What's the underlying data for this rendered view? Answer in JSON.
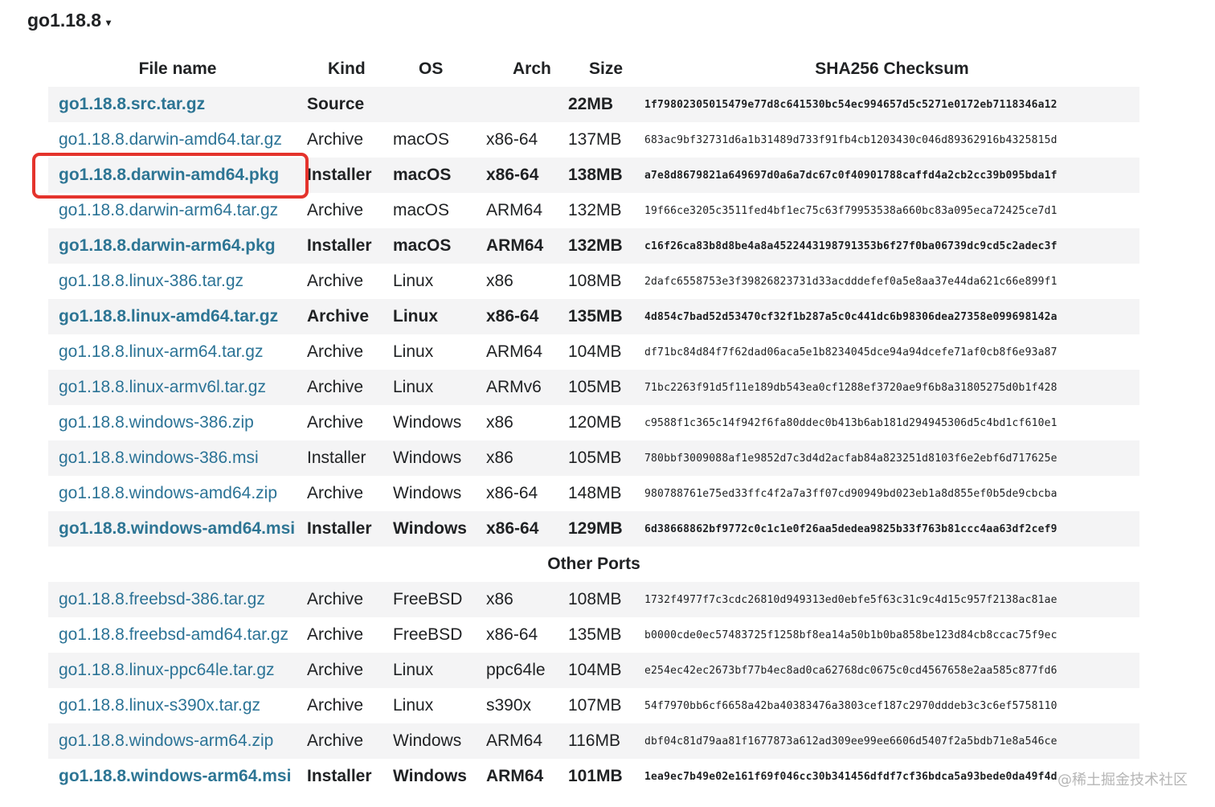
{
  "header": {
    "version": "go1.18.8",
    "caret": "▾"
  },
  "table": {
    "headers": {
      "file_name": "File name",
      "kind": "Kind",
      "os": "OS",
      "arch": "Arch",
      "size": "Size",
      "checksum": "SHA256 Checksum"
    },
    "rows": [
      {
        "name": "go1.18.8.src.tar.gz",
        "kind": "Source",
        "os": "",
        "arch": "",
        "size": "22MB",
        "sum": "1f79802305015479e77d8c641530bc54ec994657d5c5271e0172eb7118346a12",
        "featured": true,
        "shaded": true
      },
      {
        "name": "go1.18.8.darwin-amd64.tar.gz",
        "kind": "Archive",
        "os": "macOS",
        "arch": "x86-64",
        "size": "137MB",
        "sum": "683ac9bf32731d6a1b31489d733f91fb4cb1203430c046d89362916b4325815d",
        "featured": false,
        "shaded": false
      },
      {
        "name": "go1.18.8.darwin-amd64.pkg",
        "kind": "Installer",
        "os": "macOS",
        "arch": "x86-64",
        "size": "138MB",
        "sum": "a7e8d8679821a649697d0a6a7dc67c0f40901788caffd4a2cb2cc39b095bda1f",
        "featured": true,
        "shaded": true
      },
      {
        "name": "go1.18.8.darwin-arm64.tar.gz",
        "kind": "Archive",
        "os": "macOS",
        "arch": "ARM64",
        "size": "132MB",
        "sum": "19f66ce3205c3511fed4bf1ec75c63f79953538a660bc83a095eca72425ce7d1",
        "featured": false,
        "shaded": false
      },
      {
        "name": "go1.18.8.darwin-arm64.pkg",
        "kind": "Installer",
        "os": "macOS",
        "arch": "ARM64",
        "size": "132MB",
        "sum": "c16f26ca83b8d8be4a8a4522443198791353b6f27f0ba06739dc9cd5c2adec3f",
        "featured": true,
        "shaded": true
      },
      {
        "name": "go1.18.8.linux-386.tar.gz",
        "kind": "Archive",
        "os": "Linux",
        "arch": "x86",
        "size": "108MB",
        "sum": "2dafc6558753e3f39826823731d33acdddefef0a5e8aa37e44da621c66e899f1",
        "featured": false,
        "shaded": false
      },
      {
        "name": "go1.18.8.linux-amd64.tar.gz",
        "kind": "Archive",
        "os": "Linux",
        "arch": "x86-64",
        "size": "135MB",
        "sum": "4d854c7bad52d53470cf32f1b287a5c0c441dc6b98306dea27358e099698142a",
        "featured": true,
        "shaded": true
      },
      {
        "name": "go1.18.8.linux-arm64.tar.gz",
        "kind": "Archive",
        "os": "Linux",
        "arch": "ARM64",
        "size": "104MB",
        "sum": "df71bc84d84f7f62dad06aca5e1b8234045dce94a94dcefe71af0cb8f6e93a87",
        "featured": false,
        "shaded": false
      },
      {
        "name": "go1.18.8.linux-armv6l.tar.gz",
        "kind": "Archive",
        "os": "Linux",
        "arch": "ARMv6",
        "size": "105MB",
        "sum": "71bc2263f91d5f11e189db543ea0cf1288ef3720ae9f6b8a31805275d0b1f428",
        "featured": false,
        "shaded": true
      },
      {
        "name": "go1.18.8.windows-386.zip",
        "kind": "Archive",
        "os": "Windows",
        "arch": "x86",
        "size": "120MB",
        "sum": "c9588f1c365c14f942f6fa80ddec0b413b6ab181d294945306d5c4bd1cf610e1",
        "featured": false,
        "shaded": false
      },
      {
        "name": "go1.18.8.windows-386.msi",
        "kind": "Installer",
        "os": "Windows",
        "arch": "x86",
        "size": "105MB",
        "sum": "780bbf3009088af1e9852d7c3d4d2acfab84a823251d8103f6e2ebf6d717625e",
        "featured": false,
        "shaded": true
      },
      {
        "name": "go1.18.8.windows-amd64.zip",
        "kind": "Archive",
        "os": "Windows",
        "arch": "x86-64",
        "size": "148MB",
        "sum": "980788761e75ed33ffc4f2a7a3ff07cd90949bd023eb1a8d855ef0b5de9cbcba",
        "featured": false,
        "shaded": false
      },
      {
        "name": "go1.18.8.windows-amd64.msi",
        "kind": "Installer",
        "os": "Windows",
        "arch": "x86-64",
        "size": "129MB",
        "sum": "6d38668862bf9772c0c1c1e0f26aa5dedea9825b33f763b81ccc4aa63df2cef9",
        "featured": true,
        "shaded": true
      }
    ],
    "section_label": "Other Ports",
    "other_rows": [
      {
        "name": "go1.18.8.freebsd-386.tar.gz",
        "kind": "Archive",
        "os": "FreeBSD",
        "arch": "x86",
        "size": "108MB",
        "sum": "1732f4977f7c3cdc26810d949313ed0ebfe5f63c31c9c4d15c957f2138ac81ae",
        "featured": false,
        "shaded": true
      },
      {
        "name": "go1.18.8.freebsd-amd64.tar.gz",
        "kind": "Archive",
        "os": "FreeBSD",
        "arch": "x86-64",
        "size": "135MB",
        "sum": "b0000cde0ec57483725f1258bf8ea14a50b1b0ba858be123d84cb8ccac75f9ec",
        "featured": false,
        "shaded": false
      },
      {
        "name": "go1.18.8.linux-ppc64le.tar.gz",
        "kind": "Archive",
        "os": "Linux",
        "arch": "ppc64le",
        "size": "104MB",
        "sum": "e254ec42ec2673bf77b4ec8ad0ca62768dc0675c0cd4567658e2aa585c877fd6",
        "featured": false,
        "shaded": true
      },
      {
        "name": "go1.18.8.linux-s390x.tar.gz",
        "kind": "Archive",
        "os": "Linux",
        "arch": "s390x",
        "size": "107MB",
        "sum": "54f7970bb6cf6658a42ba40383476a3803cef187c2970dddeb3c3c6ef5758110",
        "featured": false,
        "shaded": false
      },
      {
        "name": "go1.18.8.windows-arm64.zip",
        "kind": "Archive",
        "os": "Windows",
        "arch": "ARM64",
        "size": "116MB",
        "sum": "dbf04c81d79aa81f1677873a612ad309ee99ee6606d5407f2a5bdb71e8a546ce",
        "featured": false,
        "shaded": true
      },
      {
        "name": "go1.18.8.windows-arm64.msi",
        "kind": "Installer",
        "os": "Windows",
        "arch": "ARM64",
        "size": "101MB",
        "sum": "1ea9ec7b49e02e161f69f046cc30b341456dfdf7cf36bdca5a93bede0da49f4d",
        "featured": true,
        "shaded": false
      }
    ]
  },
  "annotation": {
    "color": "#e4332c"
  },
  "watermark": "@稀土掘金技术社区",
  "colors": {
    "link": "#2b7396",
    "shade": "#f4f4f5",
    "text": "#202224"
  }
}
